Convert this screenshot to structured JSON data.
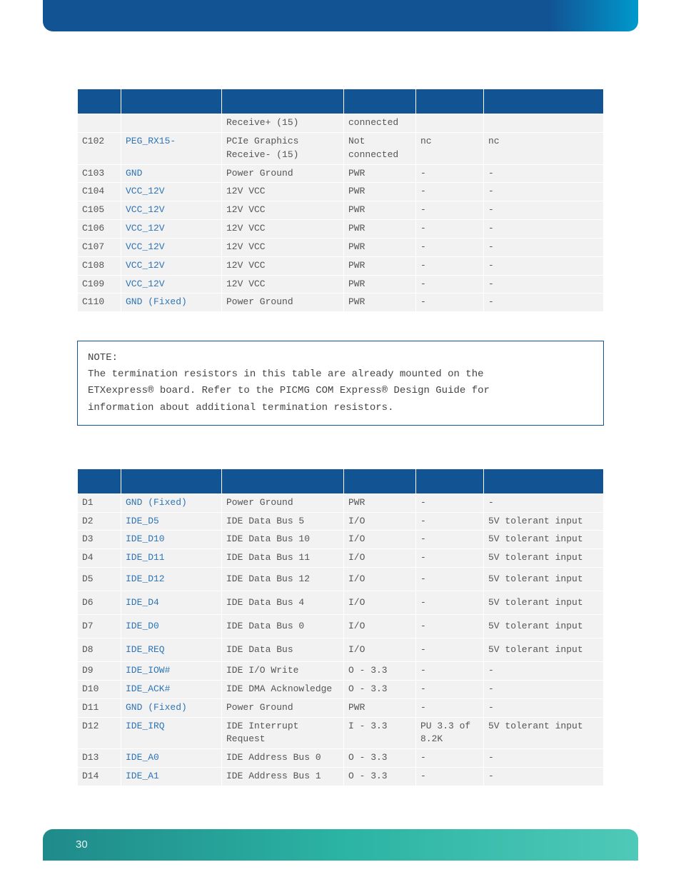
{
  "page_number": "30",
  "table1": {
    "headers": [
      "",
      "",
      "",
      "",
      "",
      ""
    ],
    "rows": [
      {
        "pin": "",
        "signal": "",
        "desc": "Receive+ (15)",
        "type": "connected",
        "term": "",
        "comment": ""
      },
      {
        "pin": "C102",
        "signal": "PEG_RX15-",
        "desc": "PCIe Graphics Receive- (15)",
        "type": "Not connected",
        "term": "nc",
        "comment": "nc"
      },
      {
        "pin": "C103",
        "signal": "GND",
        "desc": "Power Ground",
        "type": "PWR",
        "term": "-",
        "comment": "-"
      },
      {
        "pin": "C104",
        "signal": "VCC_12V",
        "desc": "12V VCC",
        "type": "PWR",
        "term": "-",
        "comment": "-"
      },
      {
        "pin": "C105",
        "signal": "VCC_12V",
        "desc": "12V VCC",
        "type": "PWR",
        "term": "-",
        "comment": "-"
      },
      {
        "pin": "C106",
        "signal": "VCC_12V",
        "desc": "12V VCC",
        "type": "PWR",
        "term": "-",
        "comment": "-"
      },
      {
        "pin": "C107",
        "signal": "VCC_12V",
        "desc": "12V VCC",
        "type": "PWR",
        "term": "-",
        "comment": "-"
      },
      {
        "pin": "C108",
        "signal": "VCC_12V",
        "desc": "12V VCC",
        "type": "PWR",
        "term": "-",
        "comment": "-"
      },
      {
        "pin": "C109",
        "signal": "VCC_12V",
        "desc": "12V VCC",
        "type": "PWR",
        "term": "-",
        "comment": "-"
      },
      {
        "pin": "C110",
        "signal": "GND (Fixed)",
        "desc": "Power Ground",
        "type": "PWR",
        "term": "-",
        "comment": "-"
      }
    ]
  },
  "note": {
    "label": "NOTE:",
    "body": "The termination resistors in this table are already mounted on the ETXexpress® board. Refer to the PICMG COM Express® Design Guide for information about additional termination resistors."
  },
  "table2": {
    "headers": [
      "",
      "",
      "",
      "",
      "",
      ""
    ],
    "rows": [
      {
        "pin": "D1",
        "signal": "GND (Fixed)",
        "desc": "Power Ground",
        "type": "PWR",
        "term": "-",
        "comment": "-"
      },
      {
        "pin": "D2",
        "signal": "IDE_D5",
        "desc": "IDE Data Bus 5",
        "type": "I/O",
        "term": "-",
        "comment": "5V tolerant input"
      },
      {
        "pin": "D3",
        "signal": "IDE_D10",
        "desc": "IDE Data Bus 10",
        "type": "I/O",
        "term": "-",
        "comment": "5V tolerant input"
      },
      {
        "pin": "D4",
        "signal": "IDE_D11",
        "desc": "IDE Data Bus 11",
        "type": "I/O",
        "term": "-",
        "comment": "5V tolerant input"
      },
      {
        "pin": "D5",
        "signal": "IDE_D12",
        "desc": "IDE Data Bus 12",
        "type": "I/O",
        "term": "-",
        "comment": "5V tolerant input"
      },
      {
        "pin": "D6",
        "signal": "IDE_D4",
        "desc": "IDE Data Bus 4",
        "type": "I/O",
        "term": "-",
        "comment": "5V tolerant input"
      },
      {
        "pin": "D7",
        "signal": "IDE_D0",
        "desc": "IDE Data Bus 0",
        "type": "I/O",
        "term": "-",
        "comment": "5V tolerant input"
      },
      {
        "pin": "D8",
        "signal": "IDE_REQ",
        "desc": "IDE Data Bus",
        "type": "I/O",
        "term": "-",
        "comment": "5V tolerant input"
      },
      {
        "pin": "D9",
        "signal": "IDE_IOW#",
        "desc": "IDE I/O Write",
        "type": "O - 3.3",
        "term": "-",
        "comment": "-"
      },
      {
        "pin": "D10",
        "signal": "IDE_ACK#",
        "desc": "IDE DMA Acknowledge",
        "type": "O - 3.3",
        "term": "-",
        "comment": "-"
      },
      {
        "pin": "D11",
        "signal": "GND (Fixed)",
        "desc": "Power Ground",
        "type": "PWR",
        "term": "-",
        "comment": "-"
      },
      {
        "pin": "D12",
        "signal": "IDE_IRQ",
        "desc": "IDE Interrupt Request",
        "type": "I - 3.3",
        "term": "PU 3.3 of 8.2K",
        "comment": "5V tolerant input"
      },
      {
        "pin": "D13",
        "signal": "IDE_A0",
        "desc": "IDE Address Bus 0",
        "type": "O - 3.3",
        "term": "-",
        "comment": "-"
      },
      {
        "pin": "D14",
        "signal": "IDE_A1",
        "desc": "IDE Address Bus 1",
        "type": "O - 3.3",
        "term": "-",
        "comment": "-"
      }
    ]
  }
}
